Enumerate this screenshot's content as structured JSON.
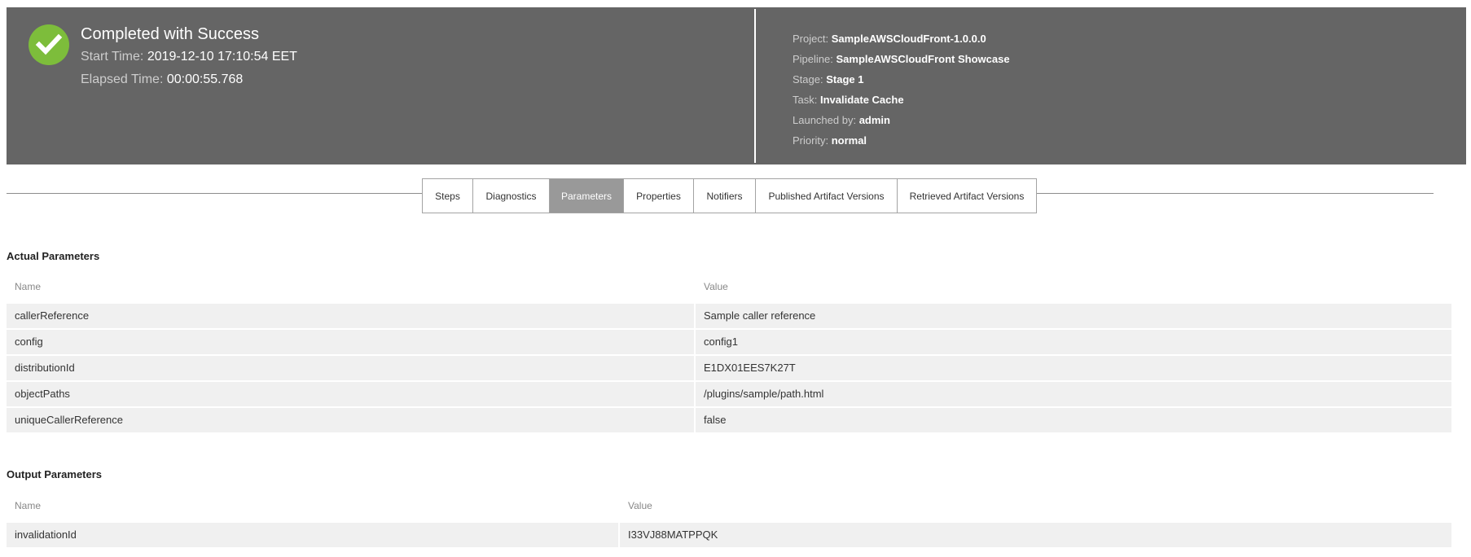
{
  "header": {
    "status": "Completed with Success",
    "start_time_label": "Start Time:",
    "start_time": "2019-12-10 17:10:54 EET",
    "elapsed_label": "Elapsed Time:",
    "elapsed": "00:00:55.768",
    "details": [
      {
        "label": "Project:",
        "value": "SampleAWSCloudFront-1.0.0.0"
      },
      {
        "label": "Pipeline:",
        "value": "SampleAWSCloudFront Showcase"
      },
      {
        "label": "Stage:",
        "value": "Stage 1"
      },
      {
        "label": "Task:",
        "value": "Invalidate Cache"
      },
      {
        "label": "Launched by:",
        "value": "admin"
      },
      {
        "label": "Priority:",
        "value": "normal"
      }
    ],
    "colors": {
      "background": "#656565",
      "success": "#7dbd3b"
    },
    "icon": "check-circle-icon"
  },
  "tabs": [
    {
      "label": "Steps",
      "active": false
    },
    {
      "label": "Diagnostics",
      "active": false
    },
    {
      "label": "Parameters",
      "active": true
    },
    {
      "label": "Properties",
      "active": false
    },
    {
      "label": "Notifiers",
      "active": false
    },
    {
      "label": "Published Artifact Versions",
      "active": false
    },
    {
      "label": "Retrieved Artifact Versions",
      "active": false
    }
  ],
  "actual_parameters": {
    "title": "Actual Parameters",
    "columns": [
      "Name",
      "Value"
    ],
    "rows": [
      {
        "name": "callerReference",
        "value": "Sample caller reference"
      },
      {
        "name": "config",
        "value": "config1"
      },
      {
        "name": "distributionId",
        "value": "E1DX01EES7K27T"
      },
      {
        "name": "objectPaths",
        "value": "/plugins/sample/path.html"
      },
      {
        "name": "uniqueCallerReference",
        "value": "false"
      }
    ]
  },
  "output_parameters": {
    "title": "Output Parameters",
    "columns": [
      "Name",
      "Value"
    ],
    "rows": [
      {
        "name": "invalidationId",
        "value": "I33VJ88MATPPQK"
      }
    ]
  }
}
